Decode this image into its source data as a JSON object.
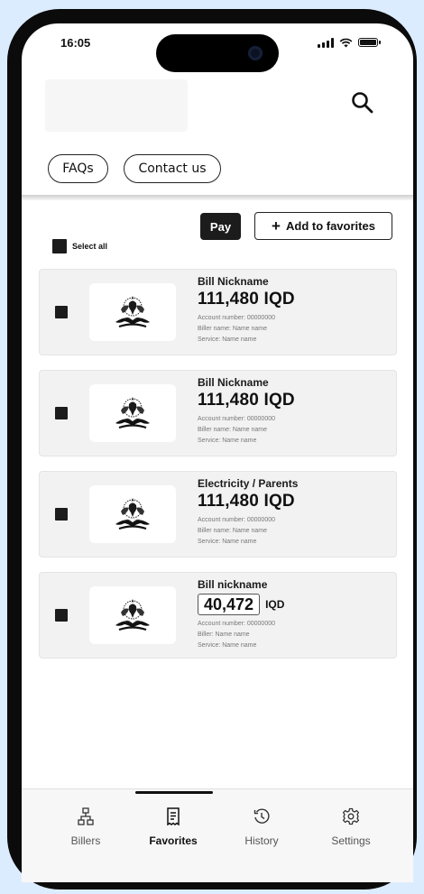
{
  "status_bar": {
    "time": "16:05"
  },
  "top_links": {
    "faqs": "FAQs",
    "contact": "Contact us"
  },
  "actions": {
    "pay": "Pay",
    "add_favorites": "Add to favorites",
    "select_all": "Select all"
  },
  "bills": [
    {
      "nickname": "Bill Nickname",
      "amount": "111,480 IQD",
      "account": "Account number: 00000000",
      "biller": "Biller name: Name name",
      "service": "Service: Name name"
    },
    {
      "nickname": "Bill Nickname",
      "amount": "111,480 IQD",
      "account": "Account number: 00000000",
      "biller": "Biller name: Name name",
      "service": "Service: Name name"
    },
    {
      "nickname": "Electricity / Parents",
      "amount": "111,480 IQD",
      "account": "Account number: 00000000",
      "biller": "Biller name: Name name",
      "service": "Service: Name name"
    },
    {
      "nickname": "Bill nickname",
      "amount_value": "40,472",
      "unit": "IQD",
      "account": "Account number: 00000000",
      "biller": "Biller: Name name",
      "service": "Service: Name name"
    }
  ],
  "nav": {
    "items": [
      {
        "label": "Billers",
        "icon": "billers-icon"
      },
      {
        "label": "Favorites",
        "icon": "favorites-icon",
        "active": true
      },
      {
        "label": "History",
        "icon": "history-icon"
      },
      {
        "label": "Settings",
        "icon": "settings-icon"
      }
    ]
  },
  "colors": {
    "accent": "#1c1c1c",
    "card_bg": "#f2f2f2",
    "frame": "#0b0b0b",
    "background": "#dcecff"
  }
}
